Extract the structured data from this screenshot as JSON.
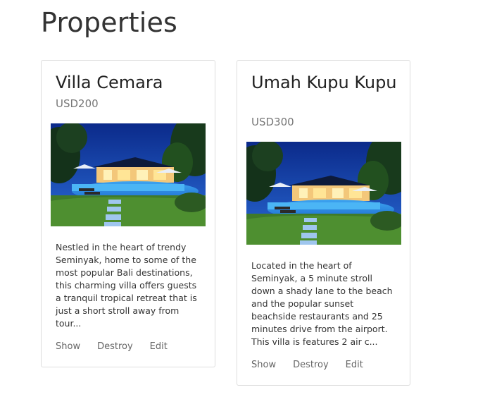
{
  "page": {
    "title": "Properties"
  },
  "properties": [
    {
      "name": "Villa Cemara",
      "price": "USD200",
      "description": "Nestled in the heart of trendy Seminyak, home to some of the most popular Bali destinations, this charming villa offers guests a tranquil tropical retreat that is just a short stroll away from tour...",
      "actions": {
        "show": "Show",
        "destroy": "Destroy",
        "edit": "Edit"
      }
    },
    {
      "name": "Umah Kupu Kupu",
      "price": "USD300",
      "description": "Located in the heart of Seminyak, a 5 minute stroll down a shady lane to the beach and the popular sunset beachside restaurants and 25 minutes drive from the airport. This villa is features 2 air c...",
      "actions": {
        "show": "Show",
        "destroy": "Destroy",
        "edit": "Edit"
      }
    }
  ],
  "colors": {
    "heading": "#333333",
    "price": "#777777",
    "link": "#666666",
    "card_border": "#dddddd"
  }
}
